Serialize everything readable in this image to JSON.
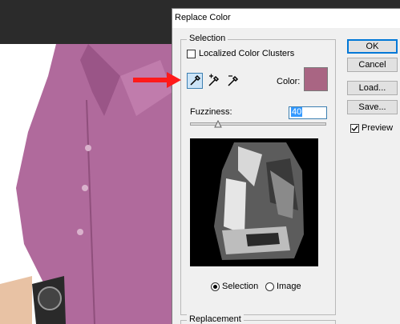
{
  "dialog": {
    "title": "Replace Color",
    "selection_legend": "Selection",
    "localized_label": "Localized Color Clusters",
    "localized_checked": false,
    "color_label": "Color:",
    "selected_color": "#a96583",
    "fuzziness_label": "Fuzziness:",
    "fuzziness_value": "40",
    "radio_selection": "Selection",
    "radio_image": "Image",
    "selected_view": "Selection",
    "replacement_legend": "Replacement"
  },
  "buttons": {
    "ok": "OK",
    "cancel": "Cancel",
    "load": "Load...",
    "save": "Save..."
  },
  "preview_option": {
    "label": "Preview",
    "checked": true
  },
  "tools": [
    "eyedropper-icon",
    "eyedropper-plus-icon",
    "eyedropper-minus-icon"
  ],
  "colors": {
    "shirt": "#b06a9c",
    "accent_arrow": "#ff1a1a",
    "focus_blue": "#0078d7"
  }
}
